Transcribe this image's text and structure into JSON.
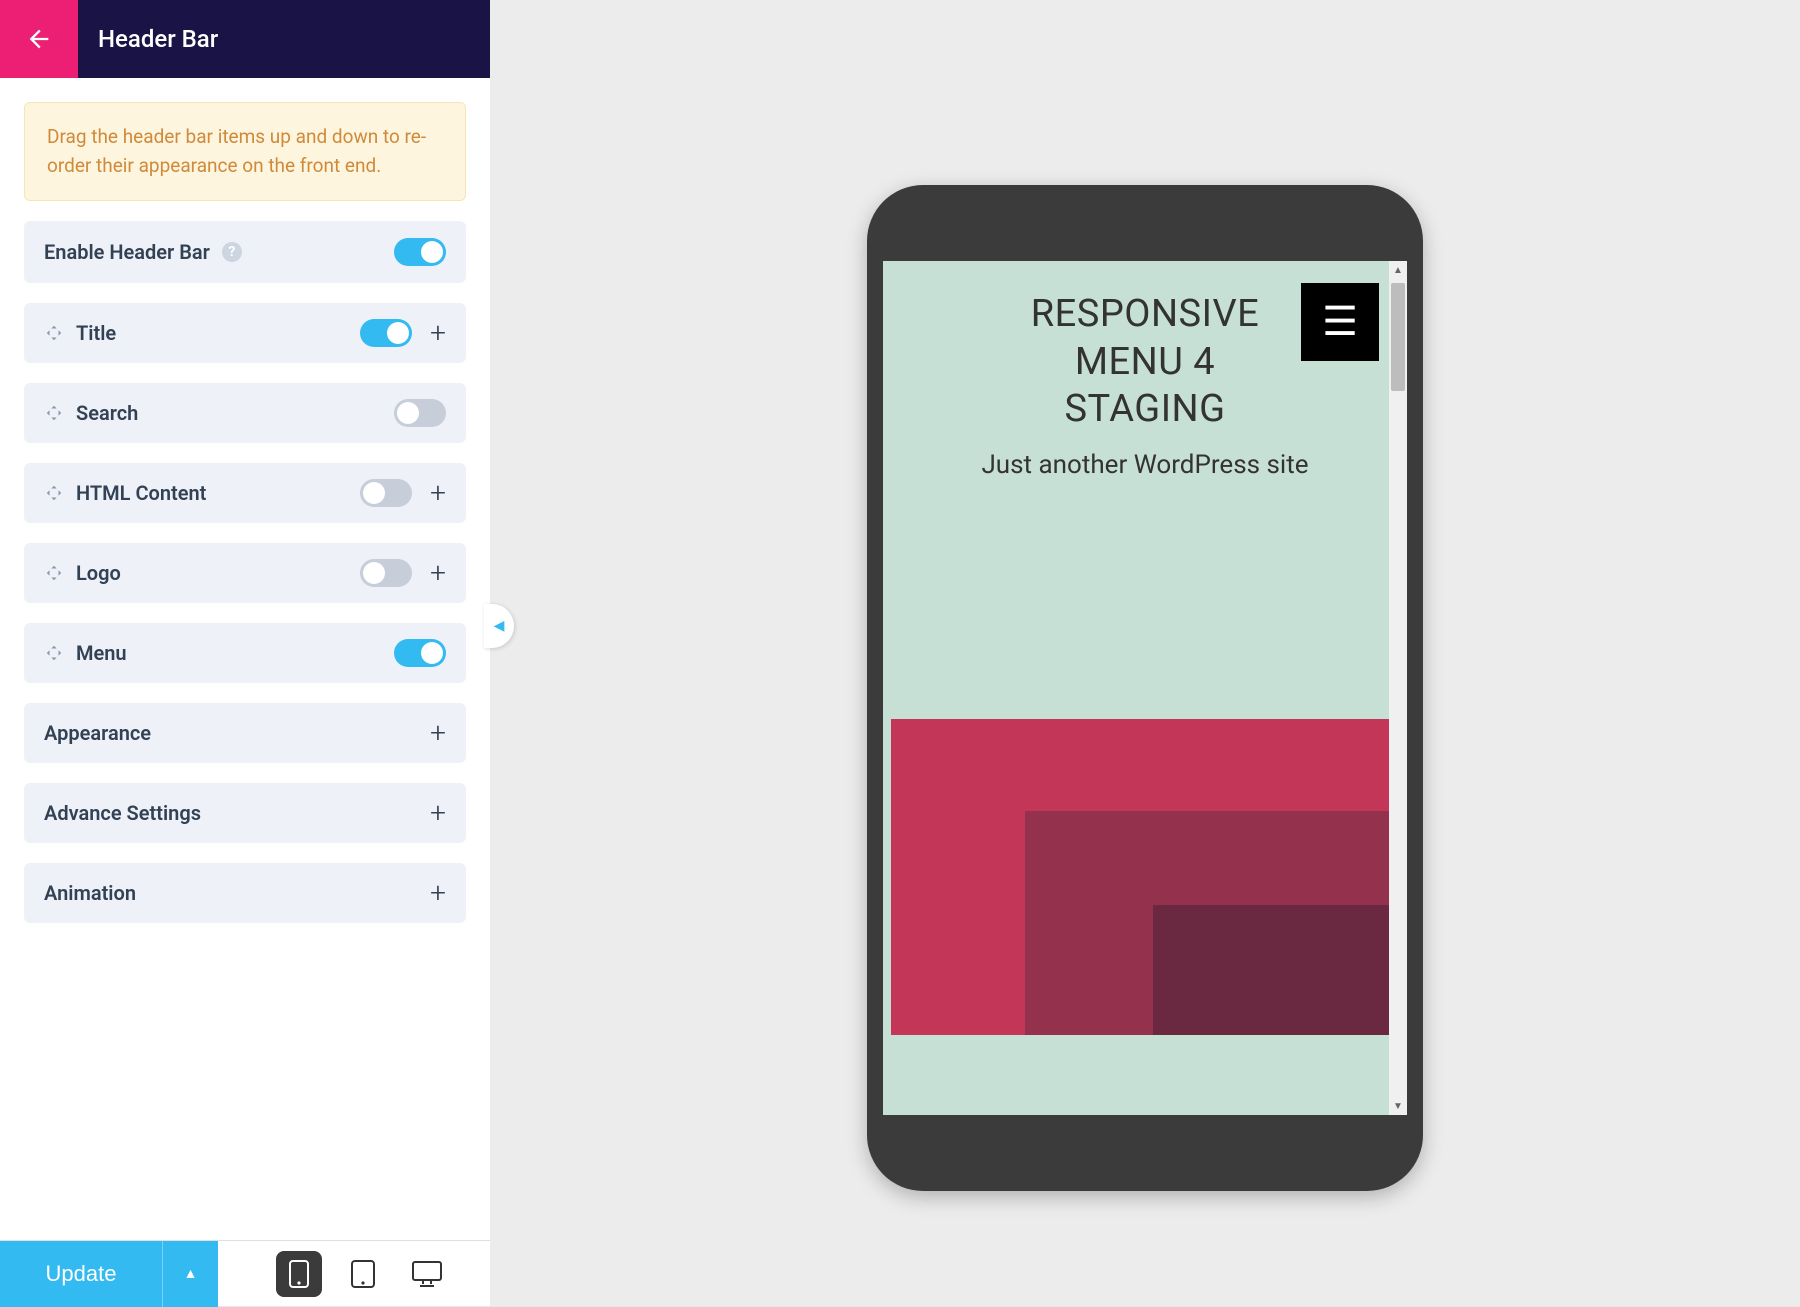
{
  "header": {
    "title": "Header Bar"
  },
  "notice": "Drag the header bar items up and down to re-order their appearance on the front end.",
  "items": {
    "enable": {
      "label": "Enable Header Bar",
      "on": true
    },
    "title": {
      "label": "Title",
      "on": true
    },
    "search": {
      "label": "Search",
      "on": false
    },
    "html": {
      "label": "HTML Content",
      "on": false
    },
    "logo": {
      "label": "Logo",
      "on": false
    },
    "menu": {
      "label": "Menu",
      "on": true
    }
  },
  "sections": {
    "appearance": "Appearance",
    "advance": "Advance Settings",
    "animation": "Animation"
  },
  "footer": {
    "update": "Update"
  },
  "preview": {
    "siteTitle": "RESPONSIVE MENU 4 STAGING",
    "tagline": "Just another WordPress site"
  }
}
